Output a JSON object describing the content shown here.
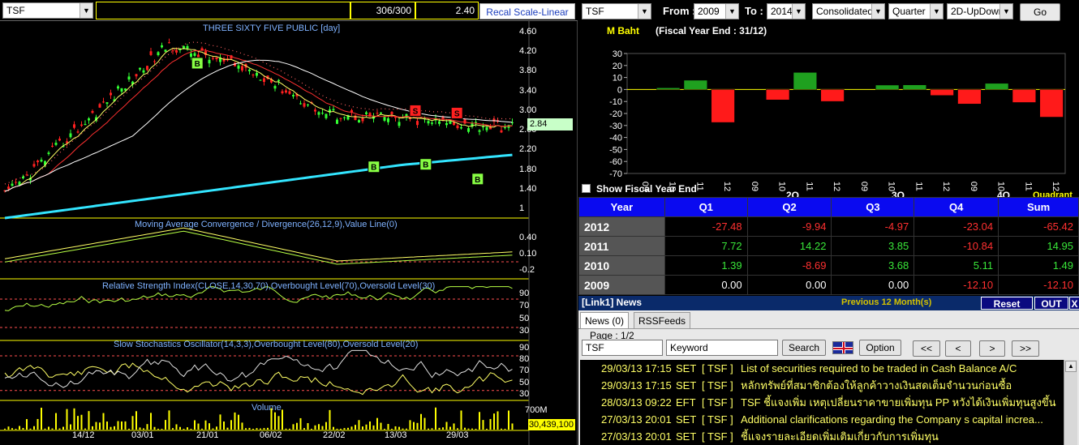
{
  "chart_toolbar": {
    "symbol": "TSF",
    "count": "306/300",
    "value": "2.40",
    "recal_label": "Recal Scale-Linear"
  },
  "price_panel": {
    "title": "THREE SIXTY FIVE PUBLIC [day]",
    "y_ticks": [
      "4.60",
      "4.20",
      "3.80",
      "3.40",
      "3.00",
      "2.60",
      "2.20",
      "1.80",
      "1.40",
      "1"
    ],
    "last_price": "2.84",
    "markers": [
      "B",
      "B",
      "S",
      "S",
      "B",
      "B",
      "B"
    ]
  },
  "macd_panel": {
    "title": "Moving Average Convergence / Divergence(26,12,9),Value Line(0)",
    "y_ticks": [
      "0.40",
      "0.10",
      "-0.2"
    ]
  },
  "rsi_panel": {
    "title": "Relative Strength Index(CLOSE,14,30,70),Overbought Level(70),Oversold Level(30)",
    "y_ticks": [
      "90",
      "70",
      "50",
      "30"
    ]
  },
  "stoch_panel": {
    "title": "Slow Stochastics Oscillator(14,3,3),Overbought Level(80),Oversold Level(20)",
    "y_ticks": [
      "90",
      "80",
      "70",
      "50",
      "30",
      "10"
    ]
  },
  "volume_panel": {
    "title": "Volume",
    "y_ticks": [
      "700M"
    ],
    "last_volume": "30,439,100"
  },
  "x_dates": [
    "14/12",
    "03/01",
    "21/01",
    "06/02",
    "22/02",
    "13/03",
    "29/03"
  ],
  "fin_toolbar": {
    "symbol": "TSF",
    "from_label": "From :",
    "from_value": "2009",
    "to_label": "To :",
    "to_value": "2014",
    "statement": "Consolidated",
    "period": "Quarter",
    "chart_type": "2D-UpDown",
    "go_label": "Go"
  },
  "fin_chart_header": {
    "unit": "M Baht",
    "fiscal": "(Fiscal Year End : 31/12)",
    "show_fiscal_label": "Show Fiscal Year End",
    "group_labels": [
      "2Q",
      "3Q",
      "4Q"
    ],
    "quadrant_label": "Quadrant"
  },
  "chart_data": {
    "type": "bar",
    "categories": [
      "09",
      "10",
      "11",
      "12",
      "09",
      "10",
      "11",
      "12",
      "09",
      "10",
      "11",
      "12",
      "09",
      "10",
      "11",
      "12"
    ],
    "values": [
      0.0,
      1.39,
      7.72,
      -27.48,
      0.0,
      -8.69,
      14.22,
      -9.94,
      0.0,
      3.68,
      3.85,
      -4.97,
      -12.1,
      5.11,
      -10.84,
      -23.04
    ],
    "title": "",
    "xlabel": "",
    "ylabel": "M Baht",
    "ylim": [
      -70,
      30
    ],
    "y_ticks": [
      30,
      20,
      10,
      0,
      -10,
      -20,
      -30,
      -40,
      -50,
      -60,
      -70
    ],
    "colors": {
      "positive": "#1fa01f",
      "negative": "#ff1a1a"
    }
  },
  "fin_table": {
    "headers": [
      "Year",
      "Q1",
      "Q2",
      "Q3",
      "Q4",
      "Sum"
    ],
    "rows": [
      {
        "year": "2012",
        "q1": "-27.48",
        "q2": "-9.94",
        "q3": "-4.97",
        "q4": "-23.04",
        "sum": "-65.42"
      },
      {
        "year": "2011",
        "q1": "7.72",
        "q2": "14.22",
        "q3": "3.85",
        "q4": "-10.84",
        "sum": "14.95"
      },
      {
        "year": "2010",
        "q1": "1.39",
        "q2": "-8.69",
        "q3": "3.68",
        "q4": "5.11",
        "sum": "1.49"
      },
      {
        "year": "2009",
        "q1": "0.00",
        "q2": "0.00",
        "q3": "0.00",
        "q4": "-12.10",
        "sum": "-12.10"
      }
    ]
  },
  "news_header": {
    "title": "[Link1] News",
    "range": "Previous 12 Month(s)",
    "reset_label": "Reset",
    "out_label": "OUT",
    "close_label": "X"
  },
  "news_tabs": [
    "News (0)",
    "RSSFeeds"
  ],
  "news_controls": {
    "page": "Page : 1/2",
    "symbol": "TSF",
    "keyword": "Keyword",
    "search_label": "Search",
    "option_label": "Option",
    "first": "<<",
    "prev": "<",
    "next": ">",
    "last": ">>"
  },
  "news_items": [
    {
      "datetime": "29/03/13 17:15",
      "source": "SET",
      "symbol": "[ TSF ]",
      "headline": "List of securities required to be traded in Cash Balance A/C"
    },
    {
      "datetime": "29/03/13 17:15",
      "source": "SET",
      "symbol": "[ TSF ]",
      "headline": "หลักทรัพย์ที่สมาชิกต้องให้ลูกค้าวางเงินสดเต็มจำนวนก่อนซื้อ"
    },
    {
      "datetime": "28/03/13 09:22",
      "source": "EFT",
      "symbol": "[ TSF ]",
      "headline": "TSF ชี้แจงเพิ่ม เหตุเปลี่ยนราคาขายเพิ่มทุน PP หวังได้เงินเพิ่มทุนสูงขึ้น  คาดอยู่ที่..."
    },
    {
      "datetime": "27/03/13 20:01",
      "source": "SET",
      "symbol": "[ TSF ]",
      "headline": "Additional clarifications regarding the Company s capital increa..."
    },
    {
      "datetime": "27/03/13 20:01",
      "source": "SET",
      "symbol": "[ TSF ]",
      "headline": "ชี้แจงรายละเอียดเพิ่มเติมเกี่ยวกับการเพิ่มทุน"
    }
  ]
}
